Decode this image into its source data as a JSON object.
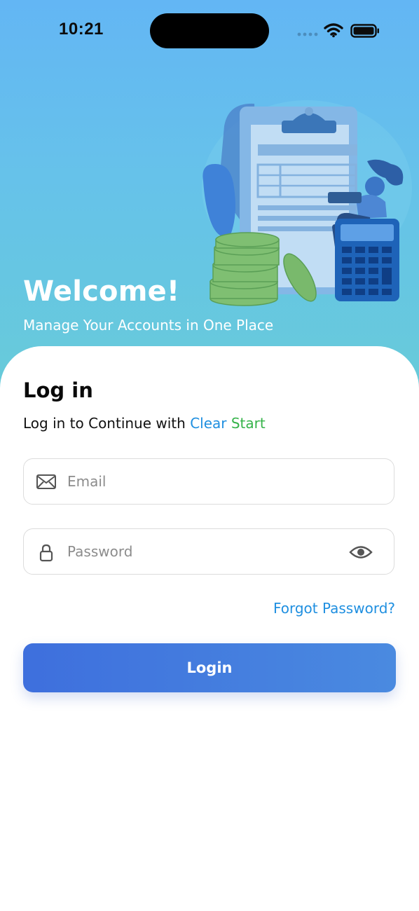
{
  "status_bar": {
    "time": "10:21",
    "signal_icon": "cellular-signal-icon",
    "wifi_icon": "wifi-icon",
    "battery_icon": "battery-icon"
  },
  "hero": {
    "title": "Welcome!",
    "subtitle": "Manage Your Accounts in One Place",
    "illustration": "accounting-illustration"
  },
  "login": {
    "title": "Log in",
    "subtitle_prefix": "Log in to Continue with",
    "brand_part1": "Clear",
    "brand_part2": "Start",
    "email": {
      "placeholder": "Email",
      "value": "",
      "icon": "mail-icon"
    },
    "password": {
      "placeholder": "Password",
      "value": "",
      "icon": "lock-icon",
      "toggle_icon": "eye-icon"
    },
    "forgot_label": "Forgot Password?",
    "button_label": "Login"
  },
  "colors": {
    "hero_top": "#63b6f4",
    "hero_bottom": "#67cbd9",
    "brand_blue": "#1f8fe0",
    "brand_green": "#36b34a",
    "button_start": "#3e6fdd",
    "button_end": "#4a8ae0"
  }
}
